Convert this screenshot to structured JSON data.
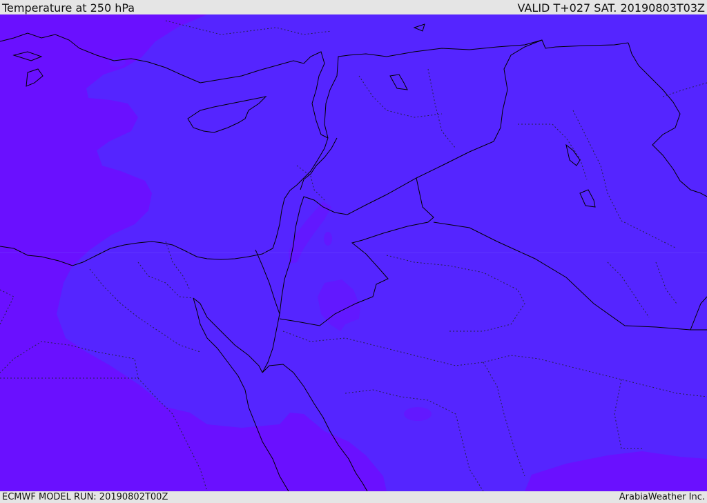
{
  "header": {
    "title": "Temperature at 250 hPa",
    "valid": "VALID T+027 SAT. 20190803T03Z"
  },
  "footer": {
    "model_run": "ECMWF MODEL RUN: 20190802T00Z",
    "credit": "ArabiaWeather Inc."
  },
  "colors": {
    "inner_field": "#5525ff",
    "outer_field": "#6a10ff",
    "warm_patch": "#6218ff",
    "coastline": "#000000",
    "border": "#000000",
    "province_border": "#222244"
  }
}
